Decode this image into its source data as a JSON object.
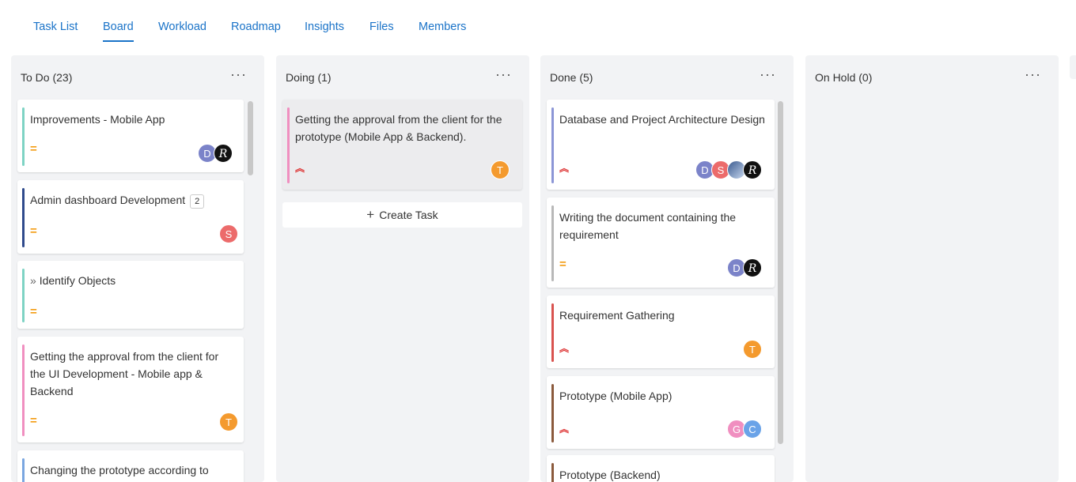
{
  "tabs": [
    {
      "label": "Task List"
    },
    {
      "label": "Board"
    },
    {
      "label": "Workload"
    },
    {
      "label": "Roadmap"
    },
    {
      "label": "Insights"
    },
    {
      "label": "Files"
    },
    {
      "label": "Members"
    }
  ],
  "columns": {
    "todo": {
      "title": "To Do (23)",
      "more": "···",
      "cards": [
        {
          "title": "Improvements - Mobile App",
          "priority": "medium",
          "bar_color": "#7ed3c4",
          "avatars": [
            "D",
            "R"
          ]
        },
        {
          "title": "Admin dashboard Development",
          "badge": "2",
          "priority": "medium",
          "bar_color": "#2f4a8c",
          "avatars": [
            "S"
          ]
        },
        {
          "title": "Identify Objects",
          "prefix_icon": "double-chevron-right-icon",
          "priority": "medium",
          "bar_color": "#7ed3c4",
          "avatars": []
        },
        {
          "title": "Getting the approval from the client for the UI Development - Mobile app & Backend",
          "priority": "medium",
          "bar_color": "#f08fc0",
          "avatars": [
            "T"
          ]
        },
        {
          "title": "Changing the prototype according to",
          "bar_color": "#7aa6e0"
        }
      ]
    },
    "doing": {
      "title": "Doing (1)",
      "more": "···",
      "cards": [
        {
          "title": "Getting the approval from the client for the prototype (Mobile App & Backend).",
          "priority": "high",
          "bar_color": "#f08fc0",
          "avatars": [
            "T"
          ]
        }
      ],
      "create_label": "Create Task",
      "create_icon": "plus-icon"
    },
    "done": {
      "title": "Done (5)",
      "more": "···",
      "cards": [
        {
          "title": "Database and Project Architecture Design",
          "priority": "high",
          "bar_color": "#8c96d6",
          "avatars": [
            "D",
            "S",
            "photo",
            "R"
          ]
        },
        {
          "title": "Writing the document containing the requirement",
          "priority": "medium",
          "bar_color": "#b8b8b8",
          "avatars": [
            "D",
            "R"
          ]
        },
        {
          "title": "Requirement Gathering",
          "priority": "high",
          "bar_color": "#d9534f",
          "avatars": [
            "T"
          ]
        },
        {
          "title": "Prototype (Mobile App)",
          "priority": "high",
          "bar_color": "#8b5a3c",
          "avatars": [
            "G",
            "C"
          ]
        },
        {
          "title": "Prototype (Backend)",
          "bar_color": "#8b5a3c"
        }
      ]
    },
    "onhold": {
      "title": "On Hold (0)",
      "more": "···",
      "cards": []
    }
  },
  "priority_icons": {
    "medium": "equals-icon",
    "high": "double-chevron-up-icon"
  },
  "colors": {
    "accent": "#1a73c8",
    "avatar_D": "#7b83c9",
    "avatar_S": "#ec6b6b",
    "avatar_T": "#f49a2e",
    "avatar_G": "#f08fc0",
    "avatar_C": "#6aa3e8"
  }
}
